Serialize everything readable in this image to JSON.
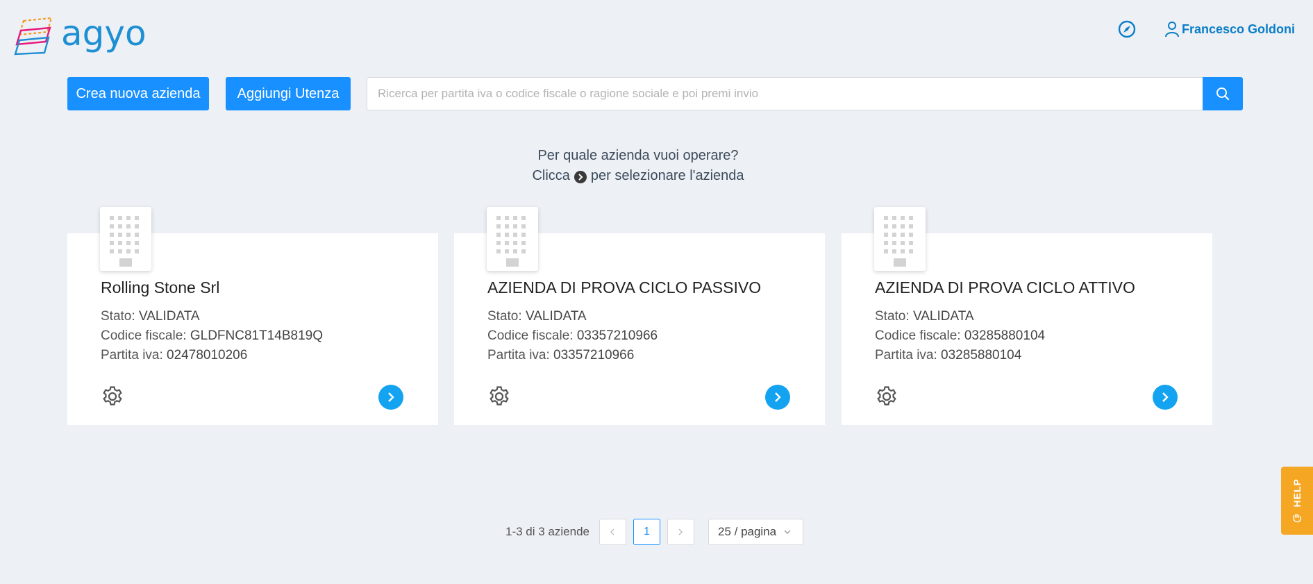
{
  "brand": {
    "name": "agyo"
  },
  "header": {
    "user_name": "Francesco Goldoni"
  },
  "toolbar": {
    "create_label": "Crea nuova azienda",
    "add_user_label": "Aggiungi Utenza",
    "search_placeholder": "Ricerca per partita iva o codice fiscale o ragione sociale e poi premi invio",
    "search_value": ""
  },
  "prompt": {
    "question": "Per quale azienda vuoi operare?",
    "hint_before": "Clicca",
    "hint_after": "per selezionare l'azienda"
  },
  "labels": {
    "stato": "Stato:",
    "codice_fiscale": "Codice fiscale:",
    "partita_iva": "Partita iva:"
  },
  "companies": [
    {
      "name": "Rolling Stone Srl",
      "stato": "VALIDATA",
      "codice_fiscale": "GLDFNC81T14B819Q",
      "partita_iva": "02478010206"
    },
    {
      "name": "AZIENDA DI PROVA CICLO PASSIVO",
      "stato": "VALIDATA",
      "codice_fiscale": "03357210966",
      "partita_iva": "03357210966"
    },
    {
      "name": "AZIENDA DI PROVA CICLO ATTIVO",
      "stato": "VALIDATA",
      "codice_fiscale": "03285880104",
      "partita_iva": "03285880104"
    }
  ],
  "pagination": {
    "total_text": "1-3 di 3 aziende",
    "current_page": "1",
    "page_size": "25 / pagina"
  },
  "help": {
    "label": "HELP"
  },
  "colors": {
    "primary": "#1890ff",
    "brand": "#1d8fd3",
    "go_button": "#14a3f0",
    "help": "#f5a623",
    "background": "#edf0f5"
  },
  "icons": [
    "logo-icon",
    "compass-icon",
    "user-icon",
    "search-icon",
    "building-icon",
    "gear-icon",
    "chevron-right-icon",
    "help-hand-icon"
  ]
}
